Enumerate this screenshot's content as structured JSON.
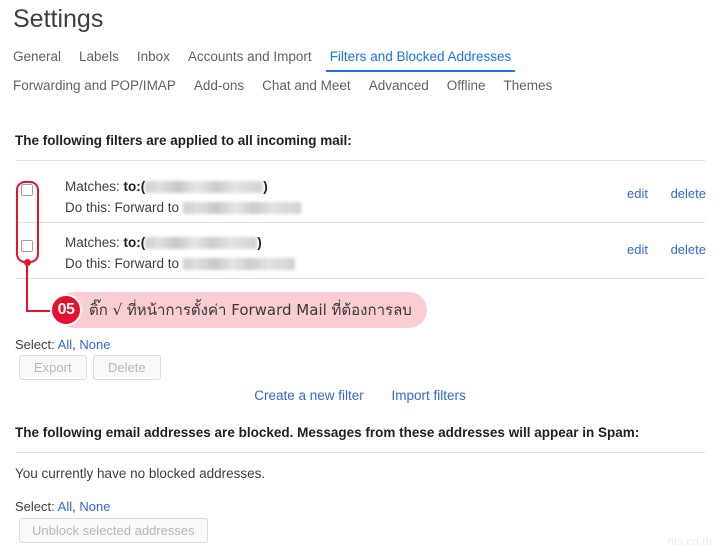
{
  "page": {
    "title": "Settings",
    "watermark": "nts.co.th"
  },
  "tabs": {
    "row1": [
      {
        "label": "General",
        "active": false
      },
      {
        "label": "Labels",
        "active": false
      },
      {
        "label": "Inbox",
        "active": false
      },
      {
        "label": "Accounts and Import",
        "active": false
      },
      {
        "label": "Filters and Blocked Addresses",
        "active": true
      }
    ],
    "row2": [
      {
        "label": "Forwarding and POP/IMAP",
        "active": false
      },
      {
        "label": "Add-ons",
        "active": false
      },
      {
        "label": "Chat and Meet",
        "active": false
      },
      {
        "label": "Advanced",
        "active": false
      },
      {
        "label": "Offline",
        "active": false
      },
      {
        "label": "Themes",
        "active": false
      }
    ]
  },
  "filters_section": {
    "heading": "The following filters are applied to all incoming mail:",
    "rows": [
      {
        "matches_label": "Matches:",
        "matches_prefix": "to:(",
        "matches_suffix": ")",
        "matches_value": "",
        "action_label": "Do this: Forward to",
        "action_value": "",
        "edit": "edit",
        "delete": "delete",
        "checked": false
      },
      {
        "matches_label": "Matches:",
        "matches_prefix": "to:(",
        "matches_suffix": ")",
        "matches_value": "",
        "action_label": "Do this: Forward to",
        "action_value": "",
        "edit": "edit",
        "delete": "delete",
        "checked": false
      }
    ],
    "select_label": "Select:",
    "select_all": "All",
    "select_sep": ",",
    "select_none": "None",
    "export_button": "Export",
    "delete_button": "Delete",
    "create_filter_link": "Create a new filter",
    "import_filters_link": "Import filters"
  },
  "blocked_section": {
    "heading": "The following email addresses are blocked. Messages from these addresses will appear in Spam:",
    "empty_message": "You currently have no blocked addresses.",
    "select_label": "Select:",
    "select_all": "All",
    "select_sep": ",",
    "select_none": "None",
    "unblock_button": "Unblock selected addresses"
  },
  "annotation": {
    "step_number": "05",
    "text": "ติ๊ก √ ที่หน้าการตั้งค่า Forward Mail ที่ต้องการลบ",
    "accent_color": "#e8112d",
    "bar_color": "#f9cdd1"
  }
}
